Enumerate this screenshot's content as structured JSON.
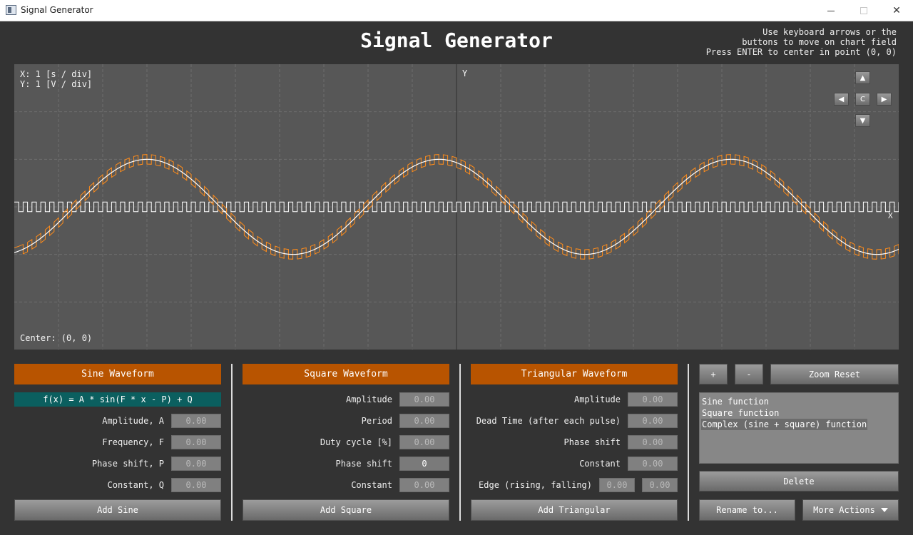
{
  "window": {
    "title": "Signal Generator"
  },
  "header": {
    "title": "Signal Generator",
    "hint_lines": [
      "Use keyboard arrows or the",
      "buttons to move on chart field",
      "Press ENTER to center in point (0, 0)"
    ]
  },
  "chart": {
    "scale_x": "X: 1 [s / div]",
    "scale_y": "Y: 1 [V / div]",
    "center": "Center: (0, 0)",
    "axis_y_label": "Y",
    "axis_x_label": "X",
    "nav": {
      "up": "▲",
      "left": "◀",
      "center": "C",
      "right": "▶",
      "down": "▼"
    }
  },
  "chart_data": {
    "type": "line",
    "x_divisions": 20,
    "y_divisions": 6,
    "grid": true,
    "series": [
      {
        "color": "#ffffff",
        "function": "sine",
        "amplitude": 1,
        "period": 6.6,
        "phase_shift": 0
      },
      {
        "color": "#ffffff",
        "function": "square",
        "amplitude": 0.2,
        "period": 0.2,
        "phase_shift": 0
      },
      {
        "color": "#ff8c1a",
        "function": "sine+square",
        "amplitude": 1,
        "period": 6.6,
        "square_amplitude": 0.2,
        "square_period": 0.2
      }
    ]
  },
  "colors": {
    "accent": "#b85400",
    "formula_bg": "#0b5f5f",
    "background": "#333333",
    "chart_bg": "#575757"
  },
  "sine": {
    "header": "Sine Waveform",
    "formula": "f(x) = A * sin(F * x - P) + Q",
    "fields": [
      {
        "label": "Amplitude, A",
        "value": "0.00"
      },
      {
        "label": "Frequency, F",
        "value": "0.00"
      },
      {
        "label": "Phase shift, P",
        "value": "0.00"
      },
      {
        "label": "Constant, Q",
        "value": "0.00"
      }
    ],
    "add_button": "Add Sine"
  },
  "square": {
    "header": "Square Waveform",
    "fields": [
      {
        "label": "Amplitude",
        "value": "0.00"
      },
      {
        "label": "Period",
        "value": "0.00"
      },
      {
        "label": "Duty cycle [%]",
        "value": "0.00"
      },
      {
        "label": "Phase shift",
        "value": "0"
      },
      {
        "label": "Constant",
        "value": "0.00"
      }
    ],
    "add_button": "Add Square"
  },
  "triangular": {
    "header": "Triangular Waveform",
    "fields": [
      {
        "label": "Amplitude",
        "value": "0.00"
      },
      {
        "label": "Dead Time (after each pulse)",
        "value": "0.00"
      },
      {
        "label": "Phase shift",
        "value": "0.00"
      },
      {
        "label": "Constant",
        "value": "0.00"
      }
    ],
    "edge": {
      "label": "Edge (rising, falling)",
      "rising": "0.00",
      "falling": "0.00"
    },
    "add_button": "Add Triangular"
  },
  "controls": {
    "zoom_in": "+",
    "zoom_out": "-",
    "zoom_reset": "Zoom Reset",
    "functions": [
      "Sine function",
      "Square function",
      "Complex (sine + square) function"
    ],
    "delete": "Delete",
    "rename": "Rename to...",
    "more_actions": "More Actions"
  }
}
